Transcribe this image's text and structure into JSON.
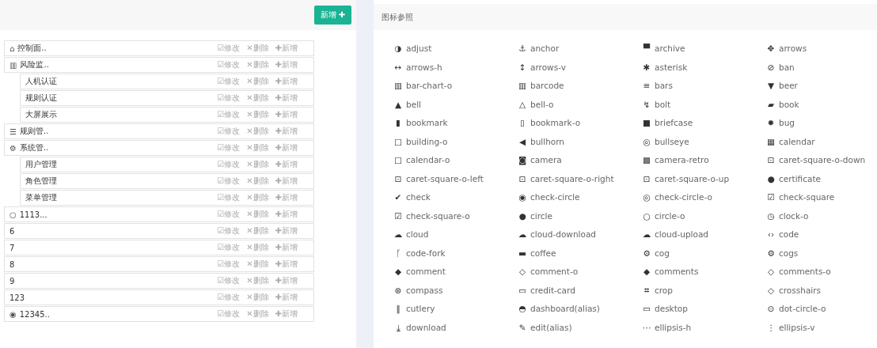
{
  "toolbar": {
    "add_button": {
      "label": "新增",
      "icon": "✚"
    }
  },
  "menu_rows": [
    {
      "icon": "⌂",
      "label": "控制面..",
      "actions": [
        {
          "icon": "☑",
          "label": "修改"
        },
        {
          "icon": "✕",
          "label": "删除"
        },
        {
          "icon": "✚",
          "label": "新增"
        }
      ]
    },
    {
      "icon": "▥",
      "label": "风险监..",
      "actions": [
        {
          "icon": "☑",
          "label": "修改"
        },
        {
          "icon": "✕",
          "label": "删除"
        },
        {
          "icon": "✚",
          "label": "新增"
        }
      ],
      "children": [
        {
          "label": "人机认证",
          "actions": [
            {
              "icon": "☑",
              "label": "修改"
            },
            {
              "icon": "✕",
              "label": "删除"
            },
            {
              "icon": "✚",
              "label": "新增"
            }
          ]
        },
        {
          "label": "规则认证",
          "actions": [
            {
              "icon": "☑",
              "label": "修改"
            },
            {
              "icon": "✕",
              "label": "删除"
            },
            {
              "icon": "✚",
              "label": "新增"
            }
          ]
        },
        {
          "label": "大屏展示",
          "actions": [
            {
              "icon": "☑",
              "label": "修改"
            },
            {
              "icon": "✕",
              "label": "删除"
            },
            {
              "icon": "✚",
              "label": "新增"
            }
          ]
        }
      ]
    },
    {
      "icon": "☰",
      "label": "规则管..",
      "actions": [
        {
          "icon": "☑",
          "label": "修改"
        },
        {
          "icon": "✕",
          "label": "删除"
        },
        {
          "icon": "✚",
          "label": "新增"
        }
      ]
    },
    {
      "icon": "⚙",
      "label": "系统管..",
      "actions": [
        {
          "icon": "☑",
          "label": "修改"
        },
        {
          "icon": "✕",
          "label": "删除"
        },
        {
          "icon": "✚",
          "label": "新增"
        }
      ],
      "children": [
        {
          "label": "用户管理",
          "actions": [
            {
              "icon": "☑",
              "label": "修改"
            },
            {
              "icon": "✕",
              "label": "删除"
            },
            {
              "icon": "✚",
              "label": "新增"
            }
          ]
        },
        {
          "label": "角色管理",
          "actions": [
            {
              "icon": "☑",
              "label": "修改"
            },
            {
              "icon": "✕",
              "label": "删除"
            },
            {
              "icon": "✚",
              "label": "新增"
            }
          ]
        },
        {
          "label": "菜单管理",
          "actions": [
            {
              "icon": "☑",
              "label": "修改"
            },
            {
              "icon": "✕",
              "label": "删除"
            },
            {
              "icon": "✚",
              "label": "新增"
            }
          ]
        }
      ]
    },
    {
      "icon": "○",
      "label": "1113...",
      "actions": [
        {
          "icon": "☑",
          "label": "修改"
        },
        {
          "icon": "✕",
          "label": "删除"
        },
        {
          "icon": "✚",
          "label": "新增"
        }
      ]
    },
    {
      "label": "6",
      "actions": [
        {
          "icon": "☑",
          "label": "修改"
        },
        {
          "icon": "✕",
          "label": "删除"
        },
        {
          "icon": "✚",
          "label": "新增"
        }
      ]
    },
    {
      "label": "7",
      "actions": [
        {
          "icon": "☑",
          "label": "修改"
        },
        {
          "icon": "✕",
          "label": "删除"
        },
        {
          "icon": "✚",
          "label": "新增"
        }
      ]
    },
    {
      "label": "8",
      "actions": [
        {
          "icon": "☑",
          "label": "修改"
        },
        {
          "icon": "✕",
          "label": "删除"
        },
        {
          "icon": "✚",
          "label": "新增"
        }
      ]
    },
    {
      "label": "9",
      "actions": [
        {
          "icon": "☑",
          "label": "修改"
        },
        {
          "icon": "✕",
          "label": "删除"
        },
        {
          "icon": "✚",
          "label": "新增"
        }
      ]
    },
    {
      "label": "123",
      "actions": [
        {
          "icon": "☑",
          "label": "修改"
        },
        {
          "icon": "✕",
          "label": "删除"
        },
        {
          "icon": "✚",
          "label": "新增"
        }
      ]
    },
    {
      "icon": "◉",
      "label": "12345..",
      "actions": [
        {
          "icon": "☑",
          "label": "修改"
        },
        {
          "icon": "✕",
          "label": "删除"
        },
        {
          "icon": "✚",
          "label": "新增"
        }
      ]
    }
  ],
  "icon_reference": {
    "title": "图标参照",
    "items": [
      {
        "icon": "◑",
        "name": "adjust"
      },
      {
        "icon": "⚓",
        "name": "anchor"
      },
      {
        "icon": "▀",
        "name": "archive"
      },
      {
        "icon": "✥",
        "name": "arrows"
      },
      {
        "icon": "↔",
        "name": "arrows-h"
      },
      {
        "icon": "↕",
        "name": "arrows-v"
      },
      {
        "icon": "✱",
        "name": "asterisk"
      },
      {
        "icon": "⊘",
        "name": "ban"
      },
      {
        "icon": "▥",
        "name": "bar-chart-o"
      },
      {
        "icon": "▥",
        "name": "barcode"
      },
      {
        "icon": "≡",
        "name": "bars"
      },
      {
        "icon": "▼",
        "name": "beer"
      },
      {
        "icon": "▲",
        "name": "bell"
      },
      {
        "icon": "△",
        "name": "bell-o"
      },
      {
        "icon": "↯",
        "name": "bolt"
      },
      {
        "icon": "▰",
        "name": "book"
      },
      {
        "icon": "▮",
        "name": "bookmark"
      },
      {
        "icon": "▯",
        "name": "bookmark-o"
      },
      {
        "icon": "■",
        "name": "briefcase"
      },
      {
        "icon": "✹",
        "name": "bug"
      },
      {
        "icon": "□",
        "name": "building-o"
      },
      {
        "icon": "◀",
        "name": "bullhorn"
      },
      {
        "icon": "◎",
        "name": "bullseye"
      },
      {
        "icon": "▦",
        "name": "calendar"
      },
      {
        "icon": "□",
        "name": "calendar-o"
      },
      {
        "icon": "◙",
        "name": "camera"
      },
      {
        "icon": "▩",
        "name": "camera-retro"
      },
      {
        "icon": "⊡",
        "name": "caret-square-o-down"
      },
      {
        "icon": "⊡",
        "name": "caret-square-o-left"
      },
      {
        "icon": "⊡",
        "name": "caret-square-o-right"
      },
      {
        "icon": "⊡",
        "name": "caret-square-o-up"
      },
      {
        "icon": "●",
        "name": "certificate"
      },
      {
        "icon": "✔",
        "name": "check"
      },
      {
        "icon": "◉",
        "name": "check-circle"
      },
      {
        "icon": "◎",
        "name": "check-circle-o"
      },
      {
        "icon": "☑",
        "name": "check-square"
      },
      {
        "icon": "☑",
        "name": "check-square-o"
      },
      {
        "icon": "●",
        "name": "circle"
      },
      {
        "icon": "○",
        "name": "circle-o"
      },
      {
        "icon": "◷",
        "name": "clock-o"
      },
      {
        "icon": "☁",
        "name": "cloud"
      },
      {
        "icon": "☁",
        "name": "cloud-download"
      },
      {
        "icon": "☁",
        "name": "cloud-upload"
      },
      {
        "icon": "‹›",
        "name": "code"
      },
      {
        "icon": "ᚴ",
        "name": "code-fork"
      },
      {
        "icon": "▬",
        "name": "coffee"
      },
      {
        "icon": "⚙",
        "name": "cog"
      },
      {
        "icon": "⚙",
        "name": "cogs"
      },
      {
        "icon": "◆",
        "name": "comment"
      },
      {
        "icon": "◇",
        "name": "comment-o"
      },
      {
        "icon": "◆",
        "name": "comments"
      },
      {
        "icon": "◇",
        "name": "comments-o"
      },
      {
        "icon": "⊛",
        "name": "compass"
      },
      {
        "icon": "▭",
        "name": "credit-card"
      },
      {
        "icon": "⌗",
        "name": "crop"
      },
      {
        "icon": "◇",
        "name": "crosshairs"
      },
      {
        "icon": "‖",
        "name": "cutlery"
      },
      {
        "icon": "◓",
        "name": "dashboard(alias)"
      },
      {
        "icon": "▭",
        "name": "desktop"
      },
      {
        "icon": "⊙",
        "name": "dot-circle-o"
      },
      {
        "icon": "⤓",
        "name": "download"
      },
      {
        "icon": "✎",
        "name": "edit(alias)"
      },
      {
        "icon": "⋯",
        "name": "ellipsis-h"
      },
      {
        "icon": "⋮",
        "name": "ellipsis-v"
      }
    ]
  }
}
